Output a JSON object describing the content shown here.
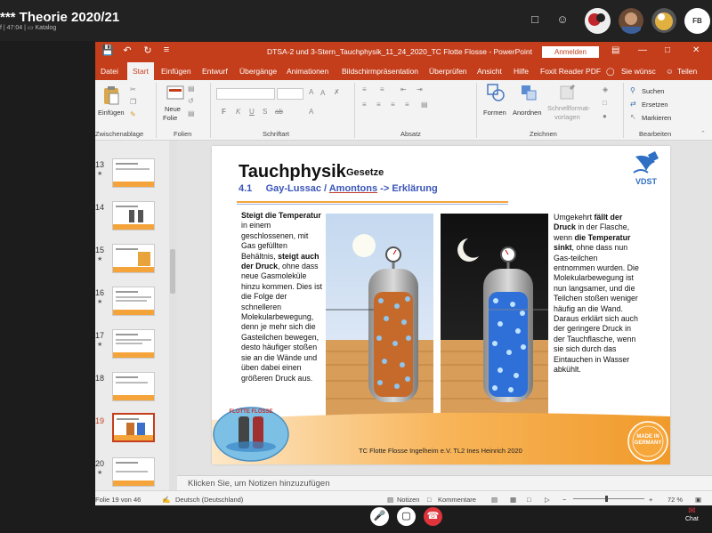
{
  "meeting": {
    "title": "*** Theorie 2020/21",
    "sub_duration": "f | 47:04 |",
    "sub_catalog": "Katalog",
    "avatar_initials": "FB",
    "chat_label": "Chat"
  },
  "window": {
    "title": "DTSA-2 und 3-Stern_Tauchphysik_11_24_2020_TC Flotte Flosse - PowerPoint",
    "signin": "Anmelden"
  },
  "tabs": [
    "Datei",
    "Start",
    "Einfügen",
    "Entwurf",
    "Übergänge",
    "Animationen",
    "Bildschirmpräsentation",
    "Überprüfen",
    "Ansicht",
    "Hilfe",
    "Foxit Reader PDF",
    "Sie wünsc",
    "Teilen"
  ],
  "ribbon": {
    "paste": "Einfügen",
    "new_slide_1": "Neue",
    "new_slide_2": "Folie",
    "shapes": "Formen",
    "arrange": "Anordnen",
    "quick_styles_1": "Schnellformat-",
    "quick_styles_2": "vorlagen",
    "find": "Suchen",
    "replace": "Ersetzen",
    "select": "Markieren",
    "groups": [
      "Zwischenablage",
      "Folien",
      "Schriftart",
      "Absatz",
      "Zeichnen",
      "Bearbeiten"
    ],
    "font_buttons": [
      "F",
      "K",
      "U",
      "S",
      "ab"
    ]
  },
  "thumbs": {
    "numbers": [
      "13",
      "14",
      "15",
      "16",
      "17",
      "18",
      "19",
      "20"
    ],
    "selected": "19"
  },
  "slide": {
    "title": "Tauchphysik",
    "title_small": "Gesetze",
    "sub_num": "4.1",
    "sub_1": "Gay-Lussac  /",
    "sub_2": "Amontons",
    "sub_3": "-> Erklärung",
    "logo": "VDST",
    "club_badge": "FLOTTE FLOSSE",
    "made_in": "MADE IN GERMANY",
    "left_text": [
      {
        "t": "Steigt die Temperatur",
        "b": true
      },
      {
        "t": " in einem geschlossenen, mit Gas gefüllten Behältnis, ",
        "b": false
      },
      {
        "t": "steigt auch der Druck",
        "b": true
      },
      {
        "t": ", ohne dass neue Gasmoleküle hinzu kommen. Dies ist die Folge der schnelleren Molekularbewegung, denn je mehr sich die Gasteilchen bewegen, desto häufiger stoßen sie an die Wände und üben dabei einen größeren Druck aus.",
        "b": false
      }
    ],
    "right_text": [
      {
        "t": "Umgekehrt ",
        "b": false
      },
      {
        "t": "fällt der Druck",
        "b": true
      },
      {
        "t": " in der Flasche, wenn ",
        "b": false
      },
      {
        "t": "die Temperatur sinkt",
        "b": true
      },
      {
        "t": ", ohne dass nun Gas-teilchen entnommen wurden. Die Molekularbewegung ist nun langsamer, und die Teilchen stoßen weniger häufig an die Wand. Daraus erklärt sich auch der geringere Druck in der Tauchflasche, wenn sie sich durch das Eintauchen in Wasser abkühlt.",
        "b": false
      }
    ],
    "credit": "TC Flotte Flosse Ingelheim e.V.   TL2  Ines Heinrich     2020"
  },
  "notes_placeholder": "Klicken Sie, um Notizen hinzuzufügen",
  "status": {
    "slide_count": "Folie 19 von 46",
    "language": "Deutsch (Deutschland)",
    "notes": "Notizen",
    "comments": "Kommentare",
    "zoom": "72 %"
  }
}
